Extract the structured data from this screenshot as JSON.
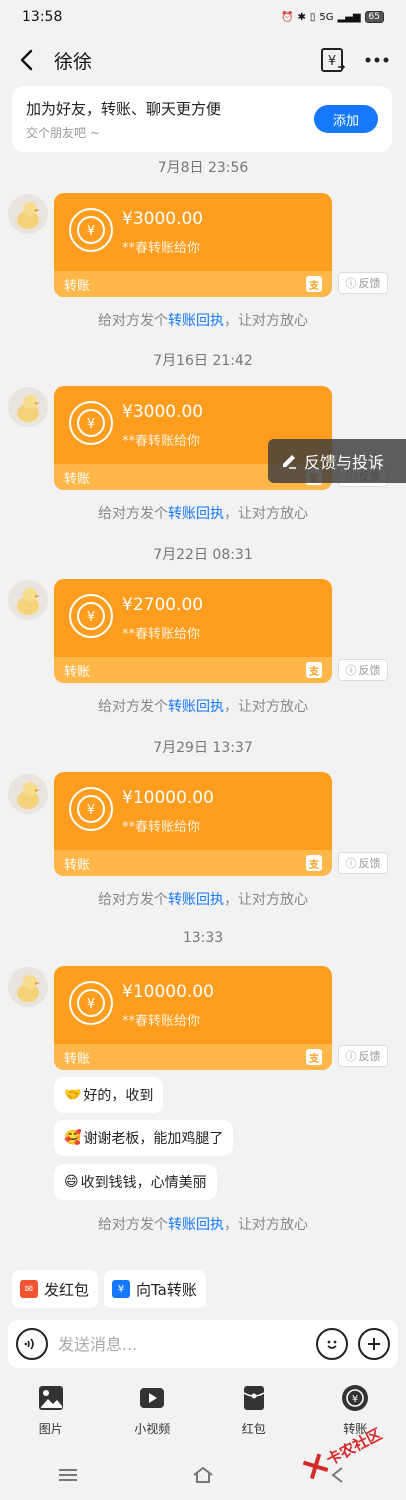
{
  "status_bar": {
    "time": "13:58",
    "battery": "65",
    "network": "5G"
  },
  "header": {
    "title": "徐徐"
  },
  "add_friend": {
    "title": "加为好友，转账、聊天更方便",
    "subtitle": "交个朋友吧 ~",
    "button": "添加"
  },
  "messages": [
    {
      "time": "7月8日 23:56",
      "amount": "¥3000.00",
      "note": "**春转账给你",
      "footer": "转账",
      "feedback": "反馈"
    },
    {
      "time": "7月16日 21:42",
      "amount": "¥3000.00",
      "note": "**春转账给你",
      "footer": "转账",
      "feedback": "反馈"
    },
    {
      "time": "7月22日 08:31",
      "amount": "¥2700.00",
      "note": "**春转账给你",
      "footer": "转账",
      "feedback": "反馈"
    },
    {
      "time": "7月29日 13:37",
      "amount": "¥10000.00",
      "note": "**春转账给你",
      "footer": "转账",
      "feedback": "反馈"
    },
    {
      "time": "13:33",
      "amount": "¥10000.00",
      "note": "**春转账给你",
      "footer": "转账",
      "feedback": "反馈"
    }
  ],
  "receipt": {
    "prefix": "给对方发个",
    "link": "转账回执",
    "suffix": "，让对方放心"
  },
  "replies": [
    {
      "emoji": "🤝",
      "text": "好的，收到"
    },
    {
      "emoji": "🥰",
      "text": "谢谢老板，能加鸡腿了"
    },
    {
      "emoji": "😄",
      "text": "收到钱钱，心情美丽"
    }
  ],
  "float_complaint": {
    "label": "反馈与投诉"
  },
  "quick_actions": {
    "red_packet": "发红包",
    "transfer": "向Ta转账"
  },
  "input": {
    "placeholder": "发送消息..."
  },
  "toolbar": {
    "photo": "图片",
    "video": "小视频",
    "red_packet": "红包",
    "transfer": "转账"
  },
  "watermark": {
    "text": "卡农社区"
  }
}
